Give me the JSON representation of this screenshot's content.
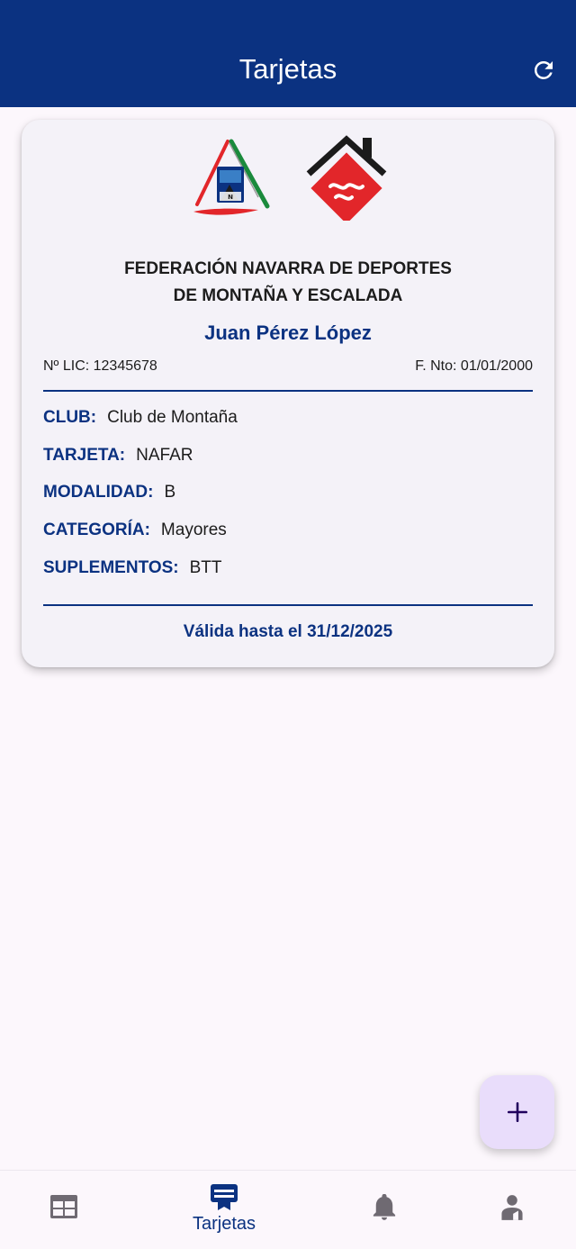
{
  "appbar": {
    "title": "Tarjetas",
    "refresh_icon": "refresh-icon"
  },
  "card": {
    "federation_line1": "FEDERACIÓN NAVARRA DE DEPORTES",
    "federation_line2": "DE MONTAÑA Y ESCALADA",
    "holder_name": "Juan Pérez López",
    "license": "Nº LIC: 12345678",
    "birth_date": "F. Nto: 01/01/2000",
    "fields": [
      {
        "label": "CLUB:",
        "value": "Club de Montaña"
      },
      {
        "label": "TARJETA:",
        "value": "NAFAR"
      },
      {
        "label": "MODALIDAD:",
        "value": "B"
      },
      {
        "label": "CATEGORÍA:",
        "value": "Mayores"
      },
      {
        "label": "SUPLEMENTOS:",
        "value": "BTT"
      }
    ],
    "validity": "Válida hasta el 31/12/2025"
  },
  "fab": {
    "icon": "plus-icon"
  },
  "nav": {
    "items": [
      {
        "icon": "calendar-grid-icon",
        "label": ""
      },
      {
        "icon": "card-icon",
        "label": "Tarjetas",
        "active": true
      },
      {
        "icon": "bell-icon",
        "label": ""
      },
      {
        "icon": "user-icon",
        "label": ""
      }
    ]
  },
  "colors": {
    "primary": "#0b3281",
    "background": "#fcf7fc",
    "card": "#f4f2f8",
    "fab": "#e9ddfb",
    "logo_red": "#e2262a",
    "logo_green": "#1a8a3c",
    "inactive_icon": "#6f6a72"
  }
}
